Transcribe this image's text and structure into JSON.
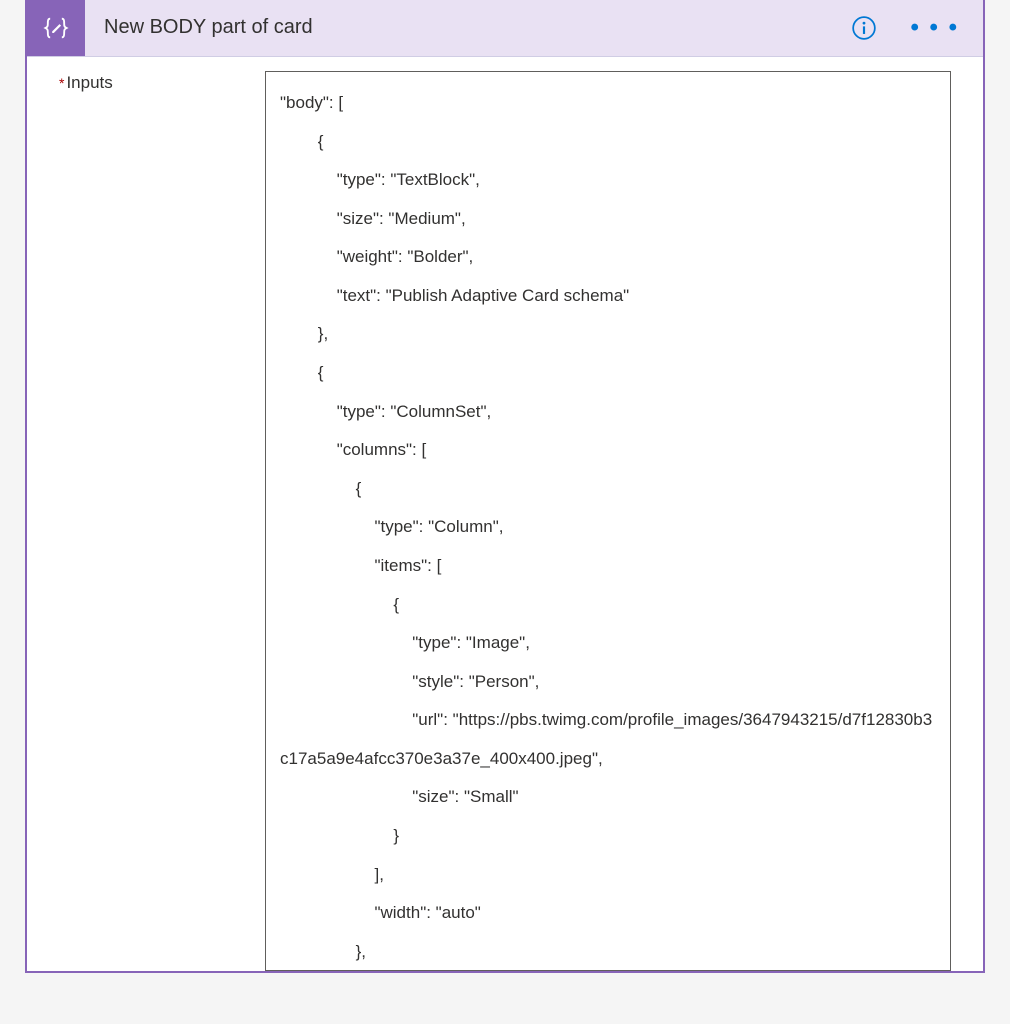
{
  "arrow": "↓",
  "header": {
    "title": "New BODY part of card"
  },
  "form": {
    "inputs_label": "Inputs",
    "code_value": "\"body\": [\n        {\n            \"type\": \"TextBlock\",\n            \"size\": \"Medium\",\n            \"weight\": \"Bolder\",\n            \"text\": \"Publish Adaptive Card schema\"\n        },\n        {\n            \"type\": \"ColumnSet\",\n            \"columns\": [\n                {\n                    \"type\": \"Column\",\n                    \"items\": [\n                        {\n                            \"type\": \"Image\",\n                            \"style\": \"Person\",\n                            \"url\": \"https://pbs.twimg.com/profile_images/3647943215/d7f12830b3c17a5a9e4afcc370e3a37e_400x400.jpeg\",\n                            \"size\": \"Small\"\n                        }\n                    ],\n                    \"width\": \"auto\"\n                },"
  }
}
